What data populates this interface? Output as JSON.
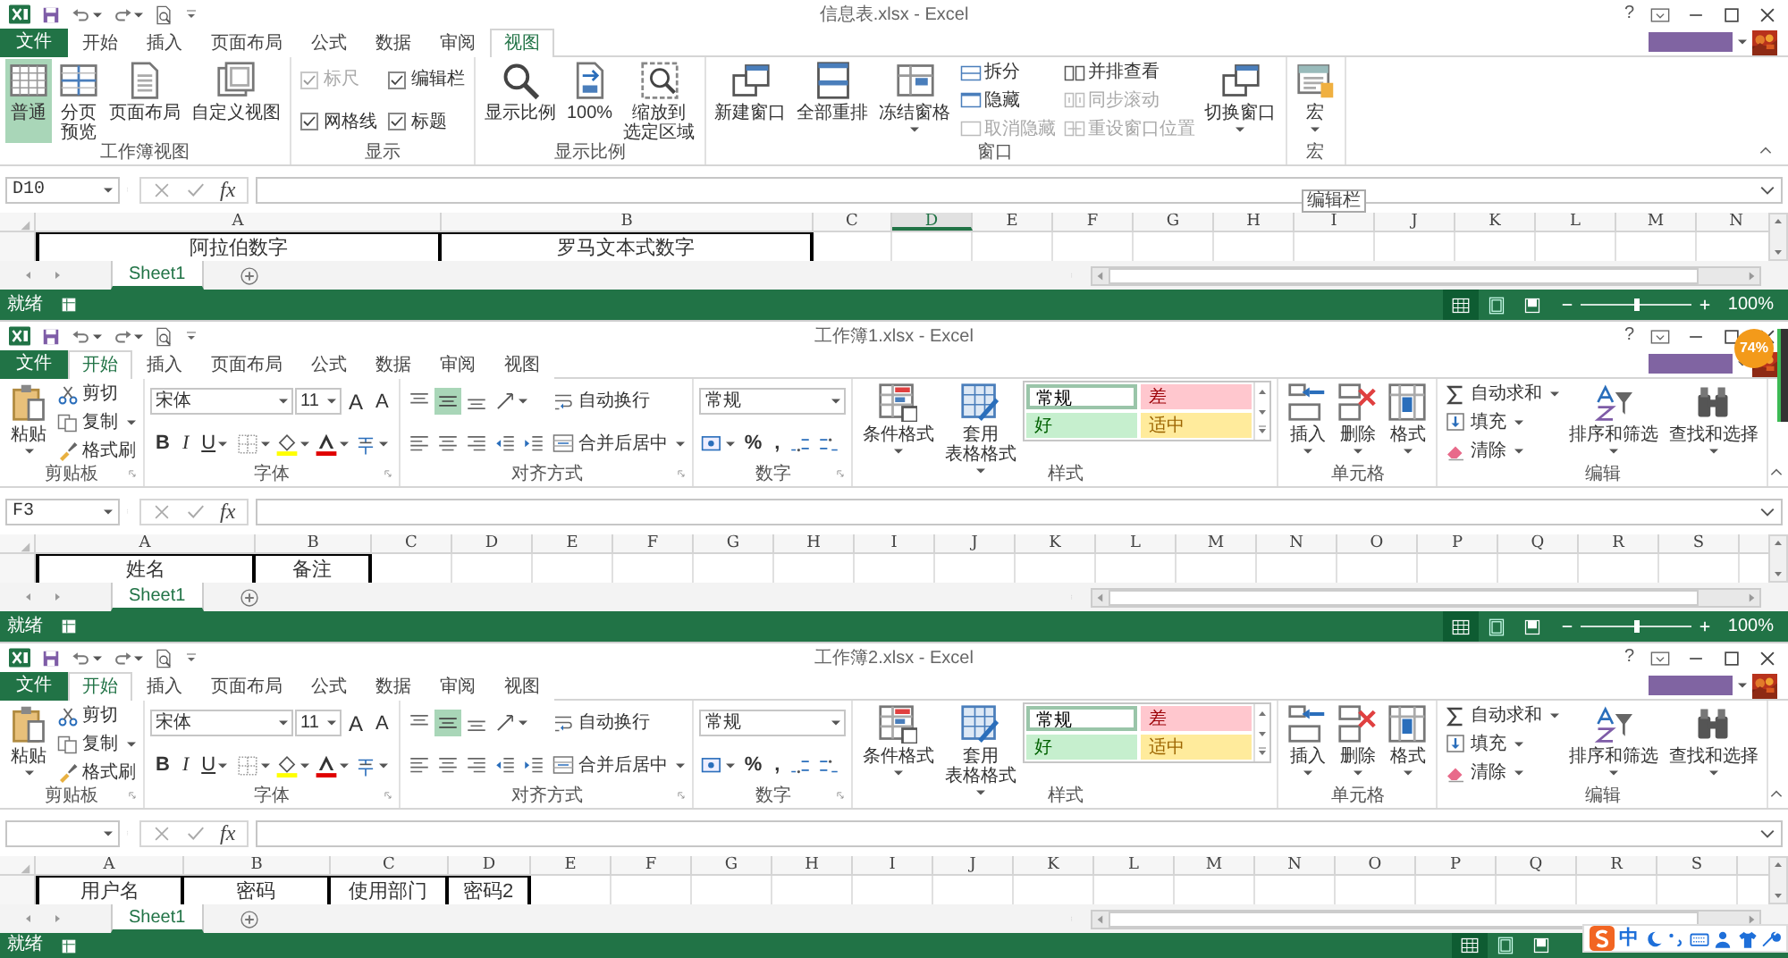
{
  "windows": [
    {
      "title": "信息表.xlsx - Excel",
      "help": "?",
      "file_tab": "文件",
      "tabs": [
        {
          "label": "开始",
          "selected": false
        },
        {
          "label": "插入",
          "selected": false
        },
        {
          "label": "页面布局",
          "selected": false
        },
        {
          "label": "公式",
          "selected": false
        },
        {
          "label": "数据",
          "selected": false
        },
        {
          "label": "审阅",
          "selected": false
        },
        {
          "label": "视图",
          "selected": true
        }
      ],
      "ribbon": {
        "kind": "view",
        "groups": [
          {
            "label": "工作簿视图",
            "columns": [
              [
                [
                  {
                    "kind": "large",
                    "lines": [
                      "普通"
                    ],
                    "selected": true
                  }
                ]
              ],
              [
                [
                  {
                    "kind": "large",
                    "lines": [
                      "分页",
                      "预览"
                    ],
                    "selected": false
                  }
                ]
              ],
              [
                [
                  {
                    "kind": "large",
                    "lines": [
                      "页面布局"
                    ],
                    "selected": false
                  }
                ]
              ],
              [
                [
                  {
                    "kind": "large",
                    "lines": [
                      "自定义视图"
                    ],
                    "selected": false
                  }
                ]
              ]
            ]
          },
          {
            "label": "显示",
            "columns": [
              [
                [
                  {
                    "kind": "check",
                    "label": "标尺",
                    "checked": true,
                    "disabled": true
                  }
                ],
                [
                  {
                    "kind": "check",
                    "label": "网格线",
                    "checked": true,
                    "disabled": false
                  }
                ]
              ],
              [
                [
                  {
                    "kind": "check",
                    "label": "编辑栏",
                    "checked": true,
                    "disabled": false
                  }
                ],
                [
                  {
                    "kind": "check",
                    "label": "标题",
                    "checked": true,
                    "disabled": false
                  }
                ]
              ]
            ]
          },
          {
            "label": "显示比例",
            "columns": [
              [
                [
                  {
                    "kind": "large",
                    "lines": [
                      "显示比例"
                    ]
                  }
                ]
              ],
              [
                [
                  {
                    "kind": "large",
                    "lines": [
                      "100%"
                    ]
                  }
                ]
              ],
              [
                [
                  {
                    "kind": "large",
                    "lines": [
                      "缩放到",
                      "选定区域"
                    ]
                  }
                ]
              ]
            ]
          },
          {
            "label": "窗口",
            "columns": [
              [
                [
                  {
                    "kind": "large",
                    "lines": [
                      "新建窗口"
                    ]
                  }
                ]
              ],
              [
                [
                  {
                    "kind": "large",
                    "lines": [
                      "全部重排"
                    ]
                  }
                ]
              ],
              [
                [
                  {
                    "kind": "large",
                    "lines": [
                      "冻结窗格"
                    ],
                    "caret": true
                  }
                ]
              ],
              [
                [
                  {
                    "kind": "small",
                    "label": "拆分",
                    "disabled": false
                  }
                ],
                [
                  {
                    "kind": "small",
                    "label": "隐藏",
                    "disabled": false
                  }
                ],
                [
                  {
                    "kind": "small",
                    "label": "取消隐藏",
                    "disabled": true
                  }
                ]
              ],
              [
                [
                  {
                    "kind": "small",
                    "label": "并排查看",
                    "disabled": false
                  }
                ],
                [
                  {
                    "kind": "small",
                    "label": "同步滚动",
                    "disabled": true
                  }
                ],
                [
                  {
                    "kind": "small",
                    "label": "重设窗口位置",
                    "disabled": true
                  }
                ]
              ],
              [
                [
                  {
                    "kind": "large",
                    "lines": [
                      "切换窗口"
                    ],
                    "caret": true
                  }
                ]
              ]
            ]
          },
          {
            "label": "宏",
            "columns": [
              [
                [
                  {
                    "kind": "large",
                    "lines": [
                      "宏"
                    ],
                    "caret": true
                  }
                ]
              ]
            ]
          }
        ]
      },
      "name_box": "D10",
      "function_label": "fx",
      "columns": [
        {
          "label": "A",
          "selected": false
        },
        {
          "label": "B",
          "selected": false
        },
        {
          "label": "C",
          "selected": false
        },
        {
          "label": "D",
          "selected": true
        },
        {
          "label": "E",
          "selected": false
        },
        {
          "label": "F",
          "selected": false
        },
        {
          "label": "G",
          "selected": false
        },
        {
          "label": "H",
          "selected": false
        },
        {
          "label": "I",
          "selected": false
        },
        {
          "label": "J",
          "selected": false
        },
        {
          "label": "K",
          "selected": false
        },
        {
          "label": "L",
          "selected": false
        },
        {
          "label": "M",
          "selected": false
        },
        {
          "label": "N",
          "selected": false
        }
      ],
      "row_1": [
        "阿拉伯数字",
        "罗马文本式数字"
      ],
      "tooltip": "编辑栏",
      "sheet_tabs": [
        {
          "label": "Sheet1",
          "selected": true
        }
      ],
      "status": "就绪",
      "view_modes": [
        {
          "selected": true
        },
        {
          "selected": false
        },
        {
          "selected": false
        }
      ],
      "zoom": {
        "level": 0.5,
        "reading": "100%"
      }
    },
    {
      "title": "工作簿1.xlsx - Excel",
      "help": "?",
      "file_tab": "文件",
      "tabs": [
        {
          "label": "开始",
          "selected": true
        },
        {
          "label": "插入",
          "selected": false
        },
        {
          "label": "页面布局",
          "selected": false
        },
        {
          "label": "公式",
          "selected": false
        },
        {
          "label": "数据",
          "selected": false
        },
        {
          "label": "审阅",
          "selected": false
        },
        {
          "label": "视图",
          "selected": false
        }
      ],
      "ribbon": {
        "kind": "home",
        "groups": [
          {
            "label": "剪贴板",
            "launcher": true,
            "columns": [
              [
                [
                  {
                    "kind": "large",
                    "lines": [
                      "粘贴"
                    ],
                    "caret": true
                  }
                ]
              ],
              [
                [
                  {
                    "kind": "small",
                    "label": "剪切"
                  }
                ],
                [
                  {
                    "kind": "small",
                    "label": "复制",
                    "caret": true
                  }
                ],
                [
                  {
                    "kind": "small",
                    "label": "格式刷"
                  }
                ]
              ]
            ]
          },
          {
            "label": "字体",
            "launcher": true,
            "columns": [
              [
                [
                  {
                    "kind": "combo",
                    "value": "宋体"
                  },
                  {
                    "kind": "combo",
                    "value": "11"
                  },
                  {
                    "kind": "grow",
                    "label": "A"
                  },
                  {
                    "kind": "shrink",
                    "label": "A"
                  }
                ],
                [
                  {
                    "kind": "bold",
                    "label": "B"
                  },
                  {
                    "kind": "italic",
                    "label": "I"
                  },
                  {
                    "kind": "underline",
                    "label": "U",
                    "caret": true
                  },
                  {
                    "kind": "icon",
                    "caret": true
                  },
                  {
                    "kind": "icon",
                    "caret": true
                  },
                  {
                    "kind": "icon",
                    "caret": true
                  },
                  {
                    "kind": "icon",
                    "caret": true
                  }
                ]
              ]
            ]
          },
          {
            "label": "对齐方式",
            "launcher": true,
            "columns": [
              [
                [
                  {
                    "kind": "icon",
                    "selected": false
                  },
                  {
                    "kind": "icon",
                    "selected": true
                  },
                  {
                    "kind": "icon",
                    "selected": false
                  },
                  {
                    "kind": "icon",
                    "selected": false,
                    "caret": true
                  }
                ],
                [
                  {
                    "kind": "icon",
                    "selected": false
                  },
                  {
                    "kind": "icon",
                    "selected": false
                  },
                  {
                    "kind": "icon",
                    "selected": false
                  },
                  {
                    "kind": "icon",
                    "selected": false
                  },
                  {
                    "kind": "icon",
                    "selected": false
                  }
                ]
              ],
              [
                [
                  {
                    "kind": "small",
                    "label": "自动换行"
                  }
                ],
                [
                  {
                    "kind": "small",
                    "label": "合并后居中",
                    "caret": true
                  }
                ]
              ]
            ]
          },
          {
            "label": "数字",
            "launcher": true,
            "columns": [
              [
                [
                  {
                    "kind": "combo",
                    "value": "常规"
                  }
                ],
                [
                  {
                    "kind": "icon",
                    "caret": true
                  },
                  {
                    "kind": "symbol",
                    "label": "%"
                  },
                  {
                    "kind": "symbol",
                    "label": ","
                  },
                  {
                    "kind": "icon"
                  },
                  {
                    "kind": "icon"
                  }
                ]
              ]
            ]
          },
          {
            "label": "样式",
            "columns": [
              [
                [
                  {
                    "kind": "large",
                    "lines": [
                      "条件格式"
                    ],
                    "caret": true
                  }
                ]
              ],
              [
                [
                  {
                    "kind": "large",
                    "lines": [
                      "套用",
                      "表格格式"
                    ],
                    "caret": true
                  }
                ]
              ],
              [
                [
                  {
                    "kind": "gallery",
                    "styles": [
                      {
                        "label": "常规",
                        "color": "#ffffff",
                        "selected": true
                      },
                      {
                        "label": "差",
                        "color": "#ffc7ce",
                        "selected": false
                      },
                      {
                        "label": "好",
                        "color": "#c6efce",
                        "selected": false
                      },
                      {
                        "label": "适中",
                        "color": "#ffeb9c",
                        "selected": false
                      }
                    ]
                  }
                ]
              ]
            ]
          },
          {
            "label": "单元格",
            "columns": [
              [
                [
                  {
                    "kind": "large",
                    "lines": [
                      "插入"
                    ],
                    "caret": true
                  }
                ]
              ],
              [
                [
                  {
                    "kind": "large",
                    "lines": [
                      "删除"
                    ],
                    "caret": true
                  }
                ]
              ],
              [
                [
                  {
                    "kind": "large",
                    "lines": [
                      "格式"
                    ],
                    "caret": true
                  }
                ]
              ]
            ]
          },
          {
            "label": "编辑",
            "columns": [
              [
                [
                  {
                    "kind": "small",
                    "label": "自动求和",
                    "caret": true
                  }
                ],
                [
                  {
                    "kind": "small",
                    "label": "填充",
                    "caret": true
                  }
                ],
                [
                  {
                    "kind": "small",
                    "label": "清除",
                    "caret": true
                  }
                ]
              ],
              [
                [
                  {
                    "kind": "large",
                    "lines": [
                      "排序和筛选"
                    ],
                    "caret": true
                  }
                ]
              ],
              [
                [
                  {
                    "kind": "large",
                    "lines": [
                      "查找和选择"
                    ],
                    "caret": true
                  }
                ]
              ]
            ]
          }
        ]
      },
      "name_box": "F3",
      "function_label": "fx",
      "columns": [
        {
          "label": "A",
          "selected": false
        },
        {
          "label": "B",
          "selected": false
        },
        {
          "label": "C",
          "selected": false
        },
        {
          "label": "D",
          "selected": false
        },
        {
          "label": "E",
          "selected": false
        },
        {
          "label": "F",
          "selected": false
        },
        {
          "label": "G",
          "selected": false
        },
        {
          "label": "H",
          "selected": false
        },
        {
          "label": "I",
          "selected": false
        },
        {
          "label": "J",
          "selected": false
        },
        {
          "label": "K",
          "selected": false
        },
        {
          "label": "L",
          "selected": false
        },
        {
          "label": "M",
          "selected": false
        },
        {
          "label": "N",
          "selected": false
        },
        {
          "label": "O",
          "selected": false
        },
        {
          "label": "P",
          "selected": false
        },
        {
          "label": "Q",
          "selected": false
        },
        {
          "label": "R",
          "selected": false
        },
        {
          "label": "S",
          "selected": false
        }
      ],
      "row_1": [
        "姓名",
        "备注"
      ],
      "badge": "74%",
      "sheet_tabs": [
        {
          "label": "Sheet1",
          "selected": true
        }
      ],
      "status": "就绪",
      "view_modes": [
        {
          "selected": true
        },
        {
          "selected": false
        },
        {
          "selected": false
        }
      ],
      "zoom": {
        "level": 0.5,
        "reading": "100%"
      }
    },
    {
      "title": "工作簿2.xlsx - Excel",
      "help": "?",
      "file_tab": "文件",
      "tabs": [
        {
          "label": "开始",
          "selected": true
        },
        {
          "label": "插入",
          "selected": false
        },
        {
          "label": "页面布局",
          "selected": false
        },
        {
          "label": "公式",
          "selected": false
        },
        {
          "label": "数据",
          "selected": false
        },
        {
          "label": "审阅",
          "selected": false
        },
        {
          "label": "视图",
          "selected": false
        }
      ],
      "ribbon": {
        "kind": "home",
        "groups": [
          {
            "label": "剪贴板",
            "launcher": true,
            "columns": [
              [
                [
                  {
                    "kind": "large",
                    "lines": [
                      "粘贴"
                    ],
                    "caret": true
                  }
                ]
              ],
              [
                [
                  {
                    "kind": "small",
                    "label": "剪切"
                  }
                ],
                [
                  {
                    "kind": "small",
                    "label": "复制",
                    "caret": true
                  }
                ],
                [
                  {
                    "kind": "small",
                    "label": "格式刷"
                  }
                ]
              ]
            ]
          },
          {
            "label": "字体",
            "launcher": true,
            "columns": [
              [
                [
                  {
                    "kind": "combo",
                    "value": "宋体"
                  },
                  {
                    "kind": "combo",
                    "value": "11"
                  },
                  {
                    "kind": "grow",
                    "label": "A"
                  },
                  {
                    "kind": "shrink",
                    "label": "A"
                  }
                ],
                [
                  {
                    "kind": "bold",
                    "label": "B"
                  },
                  {
                    "kind": "italic",
                    "label": "I"
                  },
                  {
                    "kind": "underline",
                    "label": "U",
                    "caret": true
                  },
                  {
                    "kind": "icon",
                    "caret": true
                  },
                  {
                    "kind": "icon",
                    "caret": true
                  },
                  {
                    "kind": "icon",
                    "caret": true
                  },
                  {
                    "kind": "icon",
                    "caret": true
                  }
                ]
              ]
            ]
          },
          {
            "label": "对齐方式",
            "launcher": true,
            "columns": [
              [
                [
                  {
                    "kind": "icon",
                    "selected": false
                  },
                  {
                    "kind": "icon",
                    "selected": true
                  },
                  {
                    "kind": "icon",
                    "selected": false
                  },
                  {
                    "kind": "icon",
                    "selected": false,
                    "caret": true
                  }
                ],
                [
                  {
                    "kind": "icon",
                    "selected": false
                  },
                  {
                    "kind": "icon",
                    "selected": false
                  },
                  {
                    "kind": "icon",
                    "selected": false
                  },
                  {
                    "kind": "icon",
                    "selected": false
                  },
                  {
                    "kind": "icon",
                    "selected": false
                  }
                ]
              ],
              [
                [
                  {
                    "kind": "small",
                    "label": "自动换行"
                  }
                ],
                [
                  {
                    "kind": "small",
                    "label": "合并后居中",
                    "caret": true
                  }
                ]
              ]
            ]
          },
          {
            "label": "数字",
            "launcher": true,
            "columns": [
              [
                [
                  {
                    "kind": "combo",
                    "value": "常规"
                  }
                ],
                [
                  {
                    "kind": "icon",
                    "caret": true
                  },
                  {
                    "kind": "symbol",
                    "label": "%"
                  },
                  {
                    "kind": "symbol",
                    "label": ","
                  },
                  {
                    "kind": "icon"
                  },
                  {
                    "kind": "icon"
                  }
                ]
              ]
            ]
          },
          {
            "label": "样式",
            "columns": [
              [
                [
                  {
                    "kind": "large",
                    "lines": [
                      "条件格式"
                    ],
                    "caret": true
                  }
                ]
              ],
              [
                [
                  {
                    "kind": "large",
                    "lines": [
                      "套用",
                      "表格格式"
                    ],
                    "caret": true
                  }
                ]
              ],
              [
                [
                  {
                    "kind": "gallery",
                    "styles": [
                      {
                        "label": "常规",
                        "color": "#ffffff",
                        "selected": true
                      },
                      {
                        "label": "差",
                        "color": "#ffc7ce",
                        "selected": false
                      },
                      {
                        "label": "好",
                        "color": "#c6efce",
                        "selected": false
                      },
                      {
                        "label": "适中",
                        "color": "#ffeb9c",
                        "selected": false
                      }
                    ]
                  }
                ]
              ]
            ]
          },
          {
            "label": "单元格",
            "columns": [
              [
                [
                  {
                    "kind": "large",
                    "lines": [
                      "插入"
                    ],
                    "caret": true
                  }
                ]
              ],
              [
                [
                  {
                    "kind": "large",
                    "lines": [
                      "删除"
                    ],
                    "caret": true
                  }
                ]
              ],
              [
                [
                  {
                    "kind": "large",
                    "lines": [
                      "格式"
                    ],
                    "caret": true
                  }
                ]
              ]
            ]
          },
          {
            "label": "编辑",
            "columns": [
              [
                [
                  {
                    "kind": "small",
                    "label": "自动求和",
                    "caret": true
                  }
                ],
                [
                  {
                    "kind": "small",
                    "label": "填充",
                    "caret": true
                  }
                ],
                [
                  {
                    "kind": "small",
                    "label": "清除",
                    "caret": true
                  }
                ]
              ],
              [
                [
                  {
                    "kind": "large",
                    "lines": [
                      "排序和筛选"
                    ],
                    "caret": true
                  }
                ]
              ],
              [
                [
                  {
                    "kind": "large",
                    "lines": [
                      "查找和选择"
                    ],
                    "caret": true
                  }
                ]
              ]
            ]
          }
        ]
      },
      "function_label": "fx",
      "columns": [
        {
          "label": "A",
          "selected": false
        },
        {
          "label": "B",
          "selected": false
        },
        {
          "label": "C",
          "selected": false
        },
        {
          "label": "D",
          "selected": false
        },
        {
          "label": "E",
          "selected": false
        },
        {
          "label": "F",
          "selected": false
        },
        {
          "label": "G",
          "selected": false
        },
        {
          "label": "H",
          "selected": false
        },
        {
          "label": "I",
          "selected": false
        },
        {
          "label": "J",
          "selected": false
        },
        {
          "label": "K",
          "selected": false
        },
        {
          "label": "L",
          "selected": false
        },
        {
          "label": "M",
          "selected": false
        },
        {
          "label": "N",
          "selected": false
        },
        {
          "label": "O",
          "selected": false
        },
        {
          "label": "P",
          "selected": false
        },
        {
          "label": "Q",
          "selected": false
        },
        {
          "label": "R",
          "selected": false
        },
        {
          "label": "S",
          "selected": false
        }
      ],
      "row_1": [
        "用户名",
        "密码",
        "使用部门",
        "密码2"
      ],
      "sheet_tabs": [
        {
          "label": "Sheet1",
          "selected": true
        }
      ],
      "status": "就绪",
      "view_modes": [
        {
          "selected": true
        },
        {
          "selected": false
        },
        {
          "selected": false
        }
      ],
      "ime_bar": {
        "label": "中"
      }
    }
  ]
}
